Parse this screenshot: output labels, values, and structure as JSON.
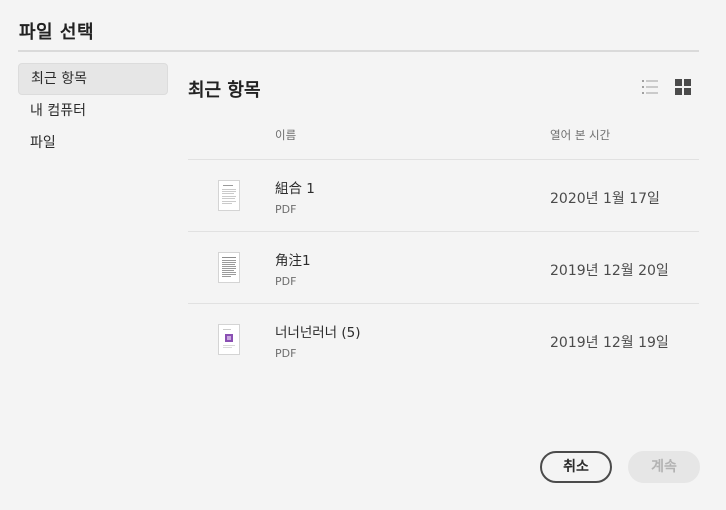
{
  "dialog": {
    "title": "파일 선택"
  },
  "sidebar": {
    "items": [
      {
        "label": "최근 항목",
        "active": true
      },
      {
        "label": "내 컴퓨터",
        "active": false
      },
      {
        "label": "파일",
        "active": false
      }
    ]
  },
  "main": {
    "title": "최근 항목",
    "view_icons": [
      "list-view-icon",
      "grid-view-icon"
    ],
    "columns": {
      "name": "이름",
      "opened": "열어 본 시간"
    },
    "files": [
      {
        "name": "組合 1",
        "type": "PDF",
        "opened": "2020년 1월 17일",
        "thumb": "text-document-thumbnail"
      },
      {
        "name": "角注1",
        "type": "PDF",
        "opened": "2019년 12월 20일",
        "thumb": "dense-text-document-thumbnail"
      },
      {
        "name": "너너넌러너 (5)",
        "type": "PDF",
        "opened": "2019년 12월 19일",
        "thumb": "image-document-thumbnail"
      }
    ]
  },
  "footer": {
    "cancel_label": "취소",
    "continue_label": "계속"
  },
  "colors": {
    "background": "#f4f4f4",
    "text": "#2c2c2c",
    "muted": "#6e6e6e",
    "disabled_button": "#e6e6e6",
    "thumbnail_accent": "#8a4fb3"
  }
}
